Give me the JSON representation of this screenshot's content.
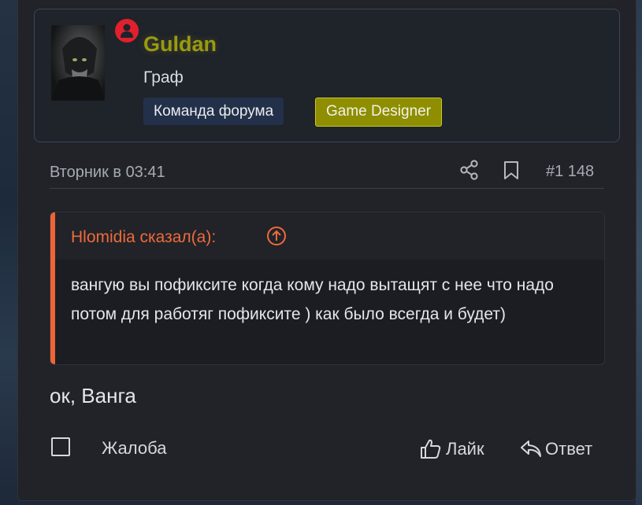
{
  "user": {
    "name": "Guldan",
    "title": "Граф",
    "badges": [
      "Команда форума",
      "Game Designer"
    ],
    "name_color": "#9a9a11",
    "status_color": "#e0202e"
  },
  "post": {
    "date": "Вторник в 03:41",
    "number": "#1 148",
    "text": "ок, Ванга"
  },
  "quote": {
    "author": "Hlomidia сказал(а):",
    "body": "вангую вы пофиксите когда кому надо вытащят с нее что надо потом для работяг пофиксите ) как было всегда и будет)",
    "accent_color": "#ee6436"
  },
  "footer": {
    "report": "Жалоба",
    "like": "Лайк",
    "reply": "Ответ"
  },
  "icons": [
    "user-status-icon",
    "share-icon",
    "bookmark-icon",
    "quote-jump-icon",
    "thumbs-up-icon",
    "reply-icon"
  ]
}
